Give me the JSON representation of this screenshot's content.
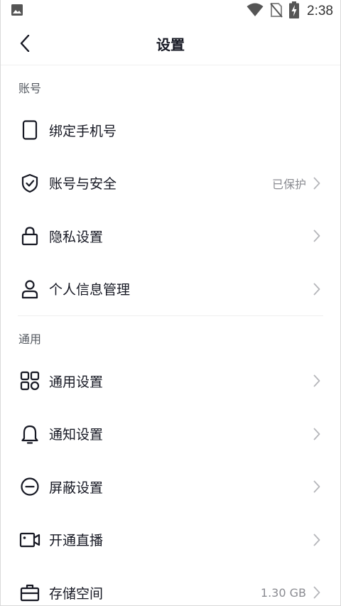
{
  "status_bar": {
    "time": "2:38",
    "icons": [
      "image-icon",
      "wifi-icon",
      "no-sim-icon",
      "battery-charging-icon"
    ]
  },
  "header": {
    "title": "设置",
    "back_icon": "chevron-left-icon"
  },
  "sections": [
    {
      "title": "账号",
      "items": [
        {
          "label": "绑定手机号",
          "icon": "phone-icon",
          "value": "",
          "chevron": false
        },
        {
          "label": "账号与安全",
          "icon": "shield-check-icon",
          "value": "已保护",
          "chevron": true
        },
        {
          "label": "隐私设置",
          "icon": "lock-icon",
          "value": "",
          "chevron": true
        },
        {
          "label": "个人信息管理",
          "icon": "person-icon",
          "value": "",
          "chevron": true
        }
      ]
    },
    {
      "title": "通用",
      "items": [
        {
          "label": "通用设置",
          "icon": "grid-icon",
          "value": "",
          "chevron": true
        },
        {
          "label": "通知设置",
          "icon": "bell-icon",
          "value": "",
          "chevron": true
        },
        {
          "label": "屏蔽设置",
          "icon": "block-icon",
          "value": "",
          "chevron": true
        },
        {
          "label": "开通直播",
          "icon": "video-camera-icon",
          "value": "",
          "chevron": true
        },
        {
          "label": "存储空间",
          "icon": "storage-box-icon",
          "value": "1.30 GB",
          "chevron": true
        }
      ]
    }
  ]
}
